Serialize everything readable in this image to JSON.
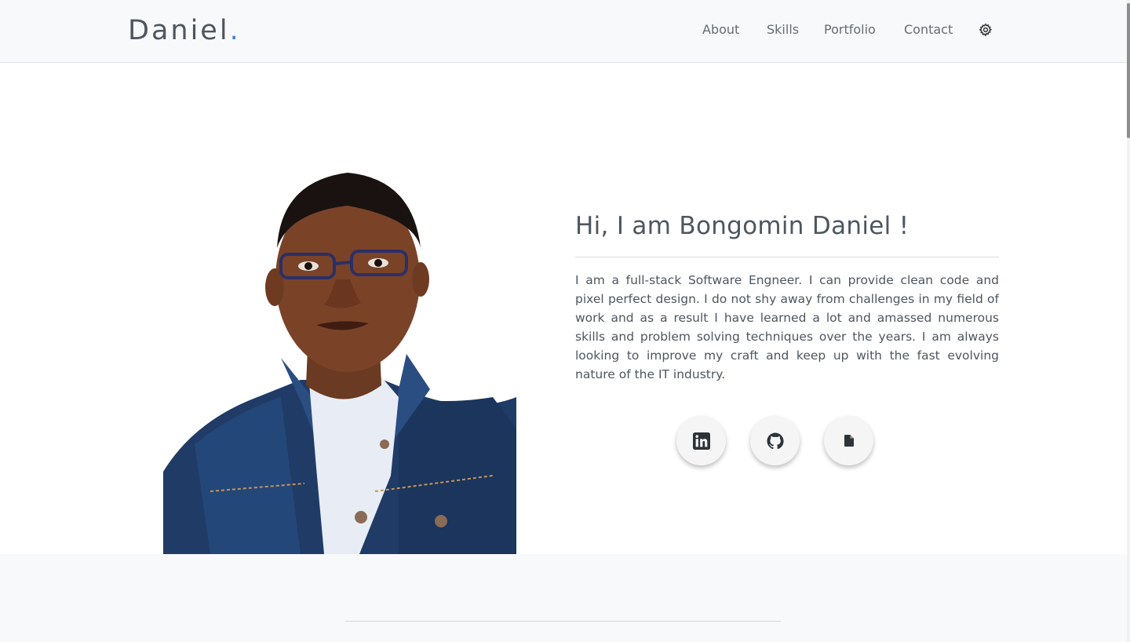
{
  "navbar": {
    "brand": "Daniel",
    "brand_dot": ".",
    "links": [
      "About",
      "Skills",
      "Portfolio",
      "Contact"
    ],
    "theme_icon": "gear-icon"
  },
  "hero": {
    "title": "Hi, I am Bongomin Daniel !",
    "description": "I am a full-stack Software Engneer. I can provide clean code and pixel perfect design. I do not shy away from challenges in my field of work and as a result I have learned a lot and amassed numerous skills and problem solving techniques over the years. I am always looking to improve my craft and keep up with the fast evolving nature of the IT industry.",
    "photo": "portrait-photo",
    "social": [
      {
        "icon": "linkedin-icon"
      },
      {
        "icon": "github-icon"
      },
      {
        "icon": "document-icon"
      }
    ]
  },
  "colors": {
    "accent": "#4a7fd1",
    "text": "#4e565f",
    "navbar_bg": "#f8f9fa"
  }
}
